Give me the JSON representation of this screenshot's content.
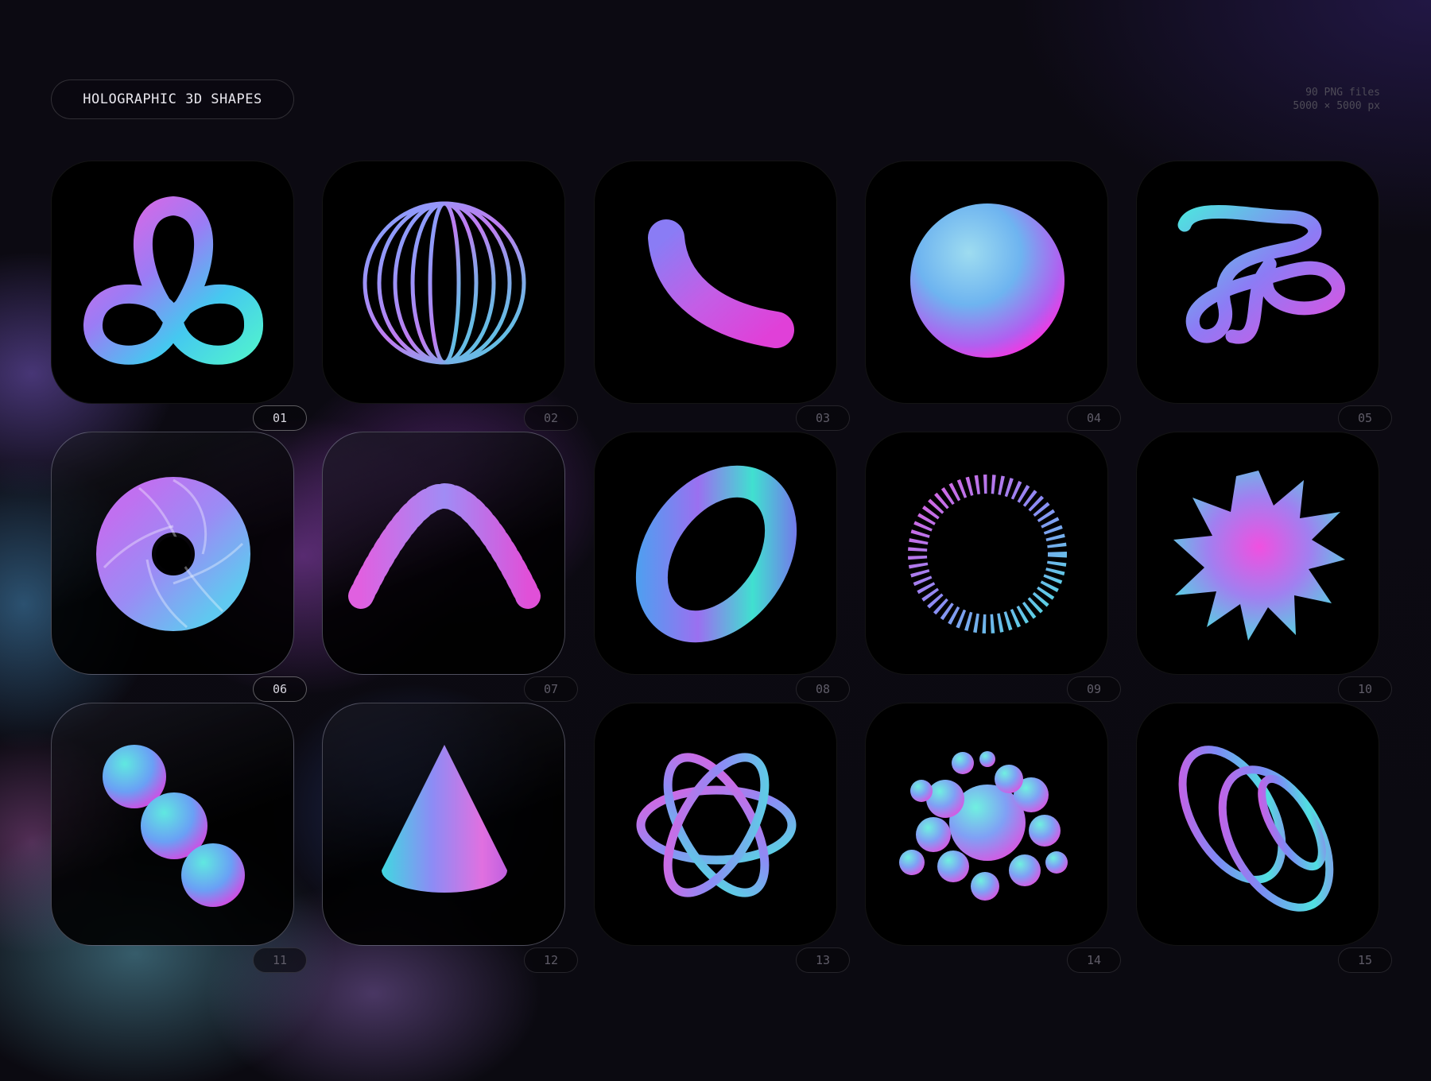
{
  "header": {
    "title": "HOLOGRAPHIC 3D SHAPES",
    "meta_line1": "90 PNG files",
    "meta_line2": "5000 × 5000 px"
  },
  "tiles": [
    {
      "number": "01",
      "icon": "trefoil-knot-icon",
      "selected": true
    },
    {
      "number": "02",
      "icon": "wire-sphere-icon",
      "selected": false
    },
    {
      "number": "03",
      "icon": "curved-tube-icon",
      "selected": false
    },
    {
      "number": "04",
      "icon": "textured-sphere-icon",
      "selected": false
    },
    {
      "number": "05",
      "icon": "tangled-knot-icon",
      "selected": false
    },
    {
      "number": "06",
      "icon": "twisted-torus-icon",
      "selected": true
    },
    {
      "number": "07",
      "icon": "coil-arc-icon",
      "selected": false
    },
    {
      "number": "08",
      "icon": "torus-icon",
      "selected": false
    },
    {
      "number": "09",
      "icon": "coil-ring-icon",
      "selected": false
    },
    {
      "number": "10",
      "icon": "spiky-ball-icon",
      "selected": false
    },
    {
      "number": "11",
      "icon": "three-balls-icon",
      "selected": false
    },
    {
      "number": "12",
      "icon": "cone-icon",
      "selected": false
    },
    {
      "number": "13",
      "icon": "atom-orbits-icon",
      "selected": false
    },
    {
      "number": "14",
      "icon": "bubble-cluster-icon",
      "selected": false
    },
    {
      "number": "15",
      "icon": "spiral-coil-icon",
      "selected": false
    }
  ],
  "colors": {
    "holo_blue": "#3fb8f0",
    "holo_cyan": "#46e6d6",
    "holo_purple": "#9b6cf0",
    "holo_pink": "#f04fd8"
  }
}
